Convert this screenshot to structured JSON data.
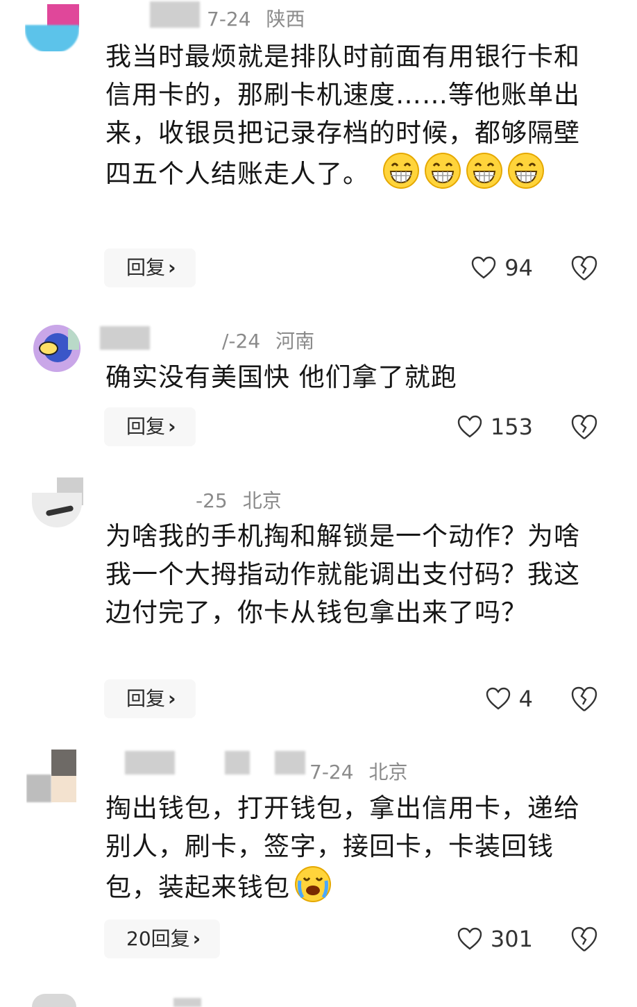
{
  "comments": [
    {
      "date": "7-24",
      "location": "陕西",
      "text": "我当时最烦就是排队时前面有用银行卡和信用卡的，那刷卡机速度……等他账单出来，收银员把记录存档的时候，都够隔壁四五个人结账走人了。",
      "emoji": [
        "grin-emoji",
        "grin-emoji",
        "grin-emoji",
        "grin-emoji"
      ],
      "reply_label": "回复",
      "likes": "94"
    },
    {
      "date": "/-24",
      "location": "河南",
      "text": "确实没有美国快 他们拿了就跑",
      "emoji": [],
      "reply_label": "回复",
      "likes": "153"
    },
    {
      "date": "-25",
      "location": "北京",
      "text": "为啥我的手机掏和解锁是一个动作？为啥我一个大拇指动作就能调出支付码？我这边付完了，你卡从钱包拿出来了吗？",
      "emoji": [],
      "reply_label": "回复",
      "likes": "4"
    },
    {
      "date": "7-24",
      "location": "北京",
      "text": "掏出钱包，打开钱包，拿出信用卡，递给别人，刷卡，签字，接回卡，卡装回钱包，装起来钱包",
      "emoji": [
        "crying-emoji"
      ],
      "reply_label": "20回复",
      "likes": "301"
    }
  ],
  "icons": {
    "like": "heart-outline-icon",
    "dislike": "broken-heart-icon",
    "chevron": "chevron-right-icon"
  },
  "colors": {
    "text": "#161616",
    "meta": "#8a8a8a",
    "reply_bg": "#f7f7f7",
    "emoji_yellow": "#ffd43b"
  }
}
